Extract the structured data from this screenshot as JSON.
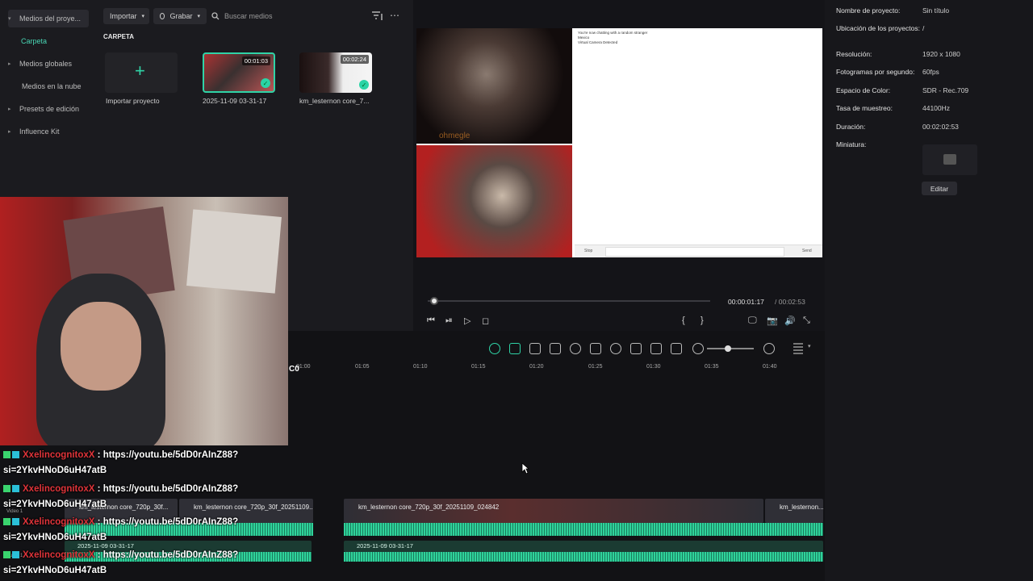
{
  "media": {
    "nav": [
      {
        "label": "Medios del proye...",
        "arrow": "▾"
      },
      {
        "label": "Carpeta",
        "arrow": ""
      },
      {
        "label": "Medios globales",
        "arrow": "▸"
      },
      {
        "label": "Medios en la nube",
        "arrow": ""
      },
      {
        "label": "Presets de edición",
        "arrow": "▸"
      },
      {
        "label": "Influence Kit",
        "arrow": "▸"
      }
    ],
    "import_label": "Importar",
    "record_label": "Grabar",
    "search_placeholder": "Buscar medios",
    "folder_title": "CARPETA",
    "items": [
      {
        "label": "Importar proyecto",
        "duration": ""
      },
      {
        "label": "2025-11-09 03-31-17",
        "duration": "00:01:03"
      },
      {
        "label": "km_lesternon core_7...",
        "duration": "00:02:24"
      }
    ]
  },
  "player": {
    "current_time": "00:00:01:17",
    "total_time": "/ 00:02:53",
    "progress": 0.01,
    "chat_header": "You're now chatting with a random stranger",
    "chat_line2": "Mexico",
    "chat_line3": "Virtual Camera Detected",
    "stop_label": "Stop",
    "send_label": "Send",
    "watermark": "ohmegle"
  },
  "properties": {
    "rows": [
      {
        "label": "Nombre de proyecto:",
        "value": "Sin título"
      },
      {
        "label": "Ubicación de los proyectos:",
        "value": "/"
      },
      {
        "label": "Resolución:",
        "value": "1920 x 1080"
      },
      {
        "label": "Fotogramas por segundo:",
        "value": "60fps"
      },
      {
        "label": "Espacio de Color:",
        "value": "SDR - Rec.709"
      },
      {
        "label": "Tasa de muestreo:",
        "value": "44100Hz"
      },
      {
        "label": "Duración:",
        "value": "00:02:02:53"
      },
      {
        "label": "Miniatura:",
        "value": ""
      }
    ],
    "edit_label": "Editar"
  },
  "timeline": {
    "ticks": [
      "01:00",
      "01:05",
      "01:10",
      "01:15",
      "01:20",
      "01:25",
      "01:30",
      "01:35",
      "01:40"
    ],
    "video_track_label": "Video 1",
    "audio_track_label": "Audio 1",
    "clips": [
      {
        "label": "km_lesternon core_720p_30f..."
      },
      {
        "label": "km_lesternon core_720p_30f_20251109..."
      },
      {
        "label": "km_lesternon core_720p_30f_20251109_024842"
      },
      {
        "label": "km_lesternon..."
      }
    ],
    "audio_clips": [
      {
        "label": "2025-11-09 03-31-17"
      },
      {
        "label": "2025-11-09 03-31-17"
      }
    ]
  },
  "chat": {
    "username": "XxelincognitoxX",
    "message": ": https://youtu.be/5dD0rAInZ88?",
    "message_cont": "si=2YkvHNoD6uH47atB"
  }
}
